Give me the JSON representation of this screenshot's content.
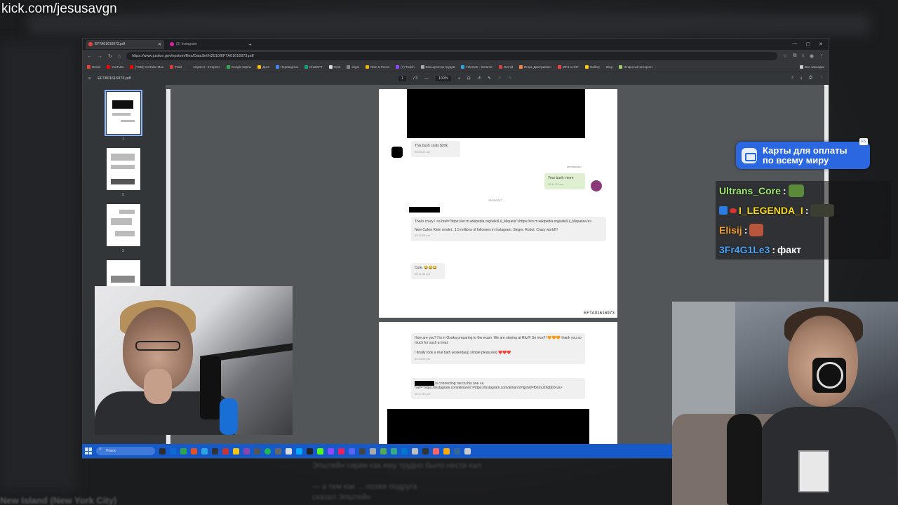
{
  "watermark": "kick.com/jesusavgn",
  "browser": {
    "tabs": [
      {
        "label": "EFTA01616973.pdf",
        "active": true
      },
      {
        "label": "(1) Instagram",
        "active": false
      }
    ],
    "url": "https://www.justice.gov/epstein/files/DataSet%2010/EFTA01616973.pdf",
    "bookmarks": [
      "Gmail",
      "YouTube",
      "[YGB] YouTube Mus",
      "Trakt",
      "ArtyBoH - Інтернет",
      "Google Карты",
      "Диск",
      "Переводчик",
      "ChatGPT",
      "Grok",
      "Gigai",
      "Ride & Prices",
      "(7) Twitch",
      "Калькулятор трудов",
      "Telemetr - Каталог",
      "Gemjit",
      "Игорь Дмитриевич",
      "MP4 to GIF",
      "Gallery",
      "Bing",
      "Открытый интернет",
      "Все закладки"
    ]
  },
  "pdf": {
    "filename": "EFTA01616973.pdf",
    "page_indicator": "1",
    "page_total": "/ 3",
    "zoom": "100%",
    "thumbnail_numbers": [
      "1",
      "2",
      "3"
    ],
    "page1": {
      "msg1": {
        "text": "This bush costs $20k",
        "time": "05:59:27 am"
      },
      "sender_label": "jamesadam",
      "msg2": {
        "text": "Your bush: more",
        "time": "05:11:22 am"
      },
      "divider_label": "28/09/2017",
      "msg3": {
        "text": "That's crazy ! <a href=\"https://en.m.wikipedia.org/wiki/Lil_Miquela\">https://en.m.wikipedia.org/wiki/Lil_Miquela</a>",
        "text2": "New Calvin Klein model.. 1.5 millions of followers in Instagram. Singer. Robot. Crazy world!!!",
        "time": "05:11:56 pm"
      },
      "msg4": {
        "text": "Cute. 😂😂😂",
        "time": "05:11:36 pm"
      },
      "page_id": "EFTA01616973"
    },
    "page2": {
      "msg1": {
        "text": "How are you? I'm in Osaka preparing to the exam. We are staying at Ritz!!! So nice!!! 🧡🧡🧡 thank you so much for such a treat.",
        "text2": "I finally took a real bath yesterday)) simple pleasure)) ❤️❤️❤️",
        "time": "05:14:34 pm"
      },
      "msg2": {
        "text": "is connecting me to this one <a href=\"https://instagram.com/alinanni\">https://instagram.com/alinanni?igshid=fbhrnu2hqbb0</a>",
        "time": "05:17:50 pm"
      }
    }
  },
  "taskbar": {
    "search_placeholder": "Поиск"
  },
  "promo": {
    "line1": "Карты для оплаты",
    "line2": "по всему миру",
    "badge": "FS"
  },
  "chat": [
    {
      "user": "Ultrans_Core",
      "color": "#9ee86e",
      "text": "",
      "emote": "#5a8a3a"
    },
    {
      "user": "I_LEGENDA_I",
      "color": "#f6d81e",
      "text": "",
      "emote": "#3b3e30"
    },
    {
      "user": "Elisij",
      "color": "#f3a12b",
      "text": "",
      "emote": "#b8563c"
    },
    {
      "user": "3Fr4G1Le3",
      "color": "#4aa3f5",
      "text": "факт",
      "emote": ""
    }
  ],
  "background_captions": [
    "Эпштейн сирии как ему трудно было нести кал",
    "— а тем как ... позже подруга",
    "сказал Эпштейн",
    "New Island (New York City)"
  ]
}
